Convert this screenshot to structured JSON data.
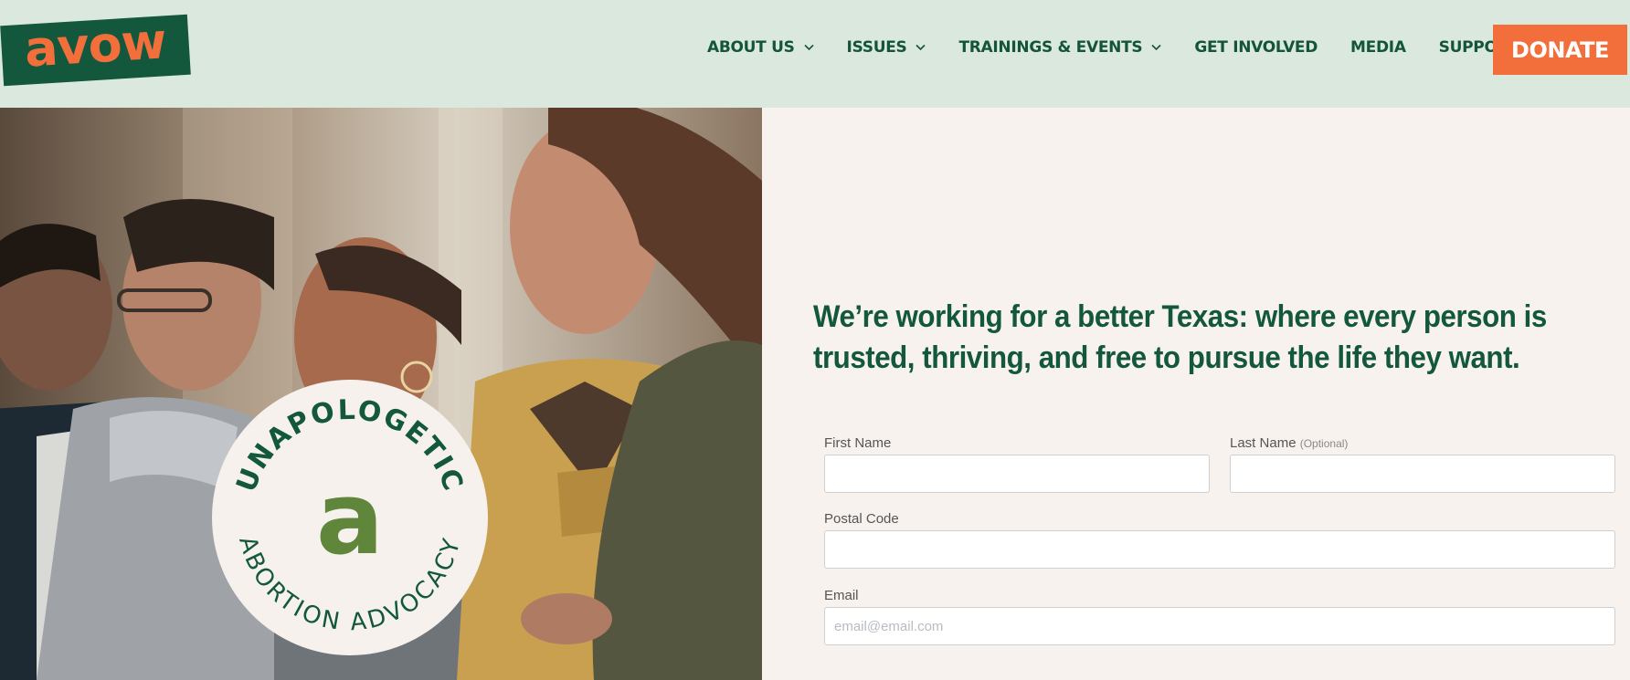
{
  "logo": {
    "text": "avow"
  },
  "nav": {
    "items": [
      {
        "label": "ABOUT US",
        "dropdown": true
      },
      {
        "label": "ISSUES",
        "dropdown": true
      },
      {
        "label": "TRAININGS & EVENTS",
        "dropdown": true
      },
      {
        "label": "GET INVOLVED",
        "dropdown": false
      },
      {
        "label": "MEDIA",
        "dropdown": false
      },
      {
        "label": "SUPPORT",
        "dropdown": true
      }
    ],
    "donate_label": "DONATE"
  },
  "badge": {
    "top_text": "UNAPOLOGETIC",
    "bottom_text": "ABORTION ADVOCACY",
    "letter": "a"
  },
  "headline": "We’re working for a better Texas: where every person is trusted, thriving, and free to pursue the life they want.",
  "form": {
    "first_name": {
      "label": "First Name",
      "value": "",
      "placeholder": ""
    },
    "last_name": {
      "label": "Last Name",
      "optional": "(Optional)",
      "value": "",
      "placeholder": ""
    },
    "postal_code": {
      "label": "Postal Code",
      "value": "",
      "placeholder": ""
    },
    "email": {
      "label": "Email",
      "value": "",
      "placeholder": "email@email.com"
    }
  },
  "colors": {
    "header_bg": "#dbe8dd",
    "brand_green": "#13583c",
    "brand_orange": "#f26f3c",
    "badge_green": "#5f863b",
    "panel_bg": "#f8f2ef"
  }
}
